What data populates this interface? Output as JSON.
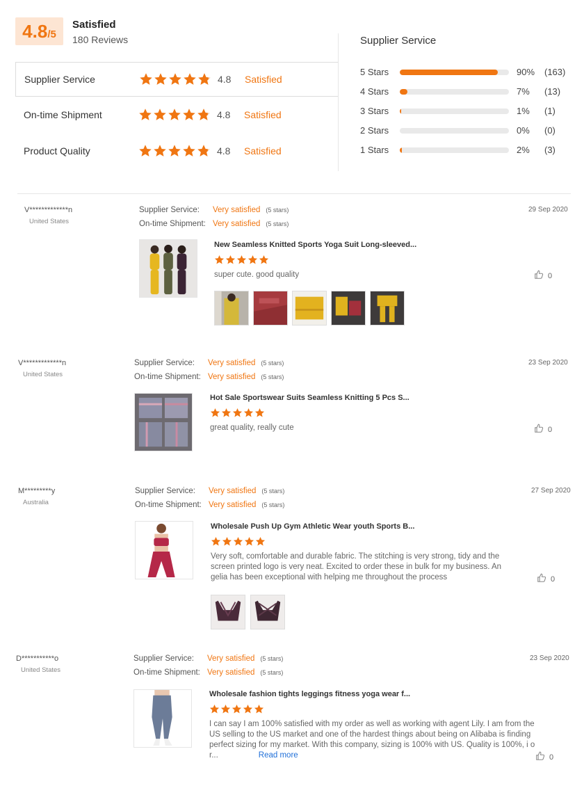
{
  "summary": {
    "score": "4.8",
    "score_suffix": "/5",
    "overall_label": "Satisfied",
    "review_count": "180 Reviews"
  },
  "categories": [
    {
      "name": "Supplier Service",
      "score": "4.8",
      "status": "Satisfied"
    },
    {
      "name": "On-time Shipment",
      "score": "4.8",
      "status": "Satisfied"
    },
    {
      "name": "Product Quality",
      "score": "4.8",
      "status": "Satisfied"
    }
  ],
  "distribution": {
    "title": "Supplier Service",
    "rows": [
      {
        "label": "5 Stars",
        "percent": 90,
        "percent_text": "90%",
        "count": "(163)"
      },
      {
        "label": "4 Stars",
        "percent": 7,
        "percent_text": "7%",
        "count": "(13)"
      },
      {
        "label": "3 Stars",
        "percent": 1,
        "percent_text": "1%",
        "count": "(1)"
      },
      {
        "label": "2 Stars",
        "percent": 0,
        "percent_text": "0%",
        "count": "(0)"
      },
      {
        "label": "1 Stars",
        "percent": 2,
        "percent_text": "2%",
        "count": "(3)"
      }
    ]
  },
  "meta_labels": {
    "supplier_service": "Supplier Service:",
    "ontime_shipment": "On-time Shipment:"
  },
  "reviews": [
    {
      "name": "V*************n",
      "country": "United States",
      "supplier_service": "Very satisfied",
      "supplier_stars": "(5 stars)",
      "shipment": "Very satisfied",
      "shipment_stars": "(5 stars)",
      "date": "29 Sep 2020",
      "product_title": "New Seamless Knitted Sports Yoga Suit Long-sleeved...",
      "text": "super cute. good quality",
      "likes": "0"
    },
    {
      "name": "V*************n",
      "country": "United States",
      "supplier_service": "Very satisfied",
      "supplier_stars": "(5 stars)",
      "shipment": "Very satisfied",
      "shipment_stars": "(5 stars)",
      "date": "23 Sep 2020",
      "product_title": "Hot Sale Sportswear Suits Seamless Knitting 5 Pcs S...",
      "text": "great quality, really cute",
      "likes": "0"
    },
    {
      "name": "M*********y",
      "country": "Australia",
      "supplier_service": "Very satisfied",
      "supplier_stars": "(5 stars)",
      "shipment": "Very satisfied",
      "shipment_stars": "(5 stars)",
      "date": "27 Sep 2020",
      "product_title": "Wholesale Push Up Gym Athletic Wear youth Sports B...",
      "text": "Very soft, comfortable and durable fabric. The stitching is very strong, tidy and the screen printed logo is very neat. Excited to order these in bulk for my business. An gelia has been exceptional with helping me throughout  the process",
      "likes": "0"
    },
    {
      "name": "D***********o",
      "country": "United States",
      "supplier_service": "Very satisfied",
      "supplier_stars": "(5 stars)",
      "shipment": "Very satisfied",
      "shipment_stars": "(5 stars)",
      "date": "23 Sep 2020",
      "product_title": "Wholesale fashion tights leggings fitness yoga wear f...",
      "text": "I can say I am 100% satisfied with my order as well as working with agent Lily. I am from the US selling to the US market and one of the hardest things about being on Alibaba is finding perfect sizing for my market. With this company, sizing is 100% with US. Quality is 100%, i o r...",
      "read_more": "Read more",
      "likes": "0"
    }
  ],
  "colors": {
    "accent": "#f07612",
    "score_bg": "#fde5d3",
    "link": "#1f6fd8"
  }
}
